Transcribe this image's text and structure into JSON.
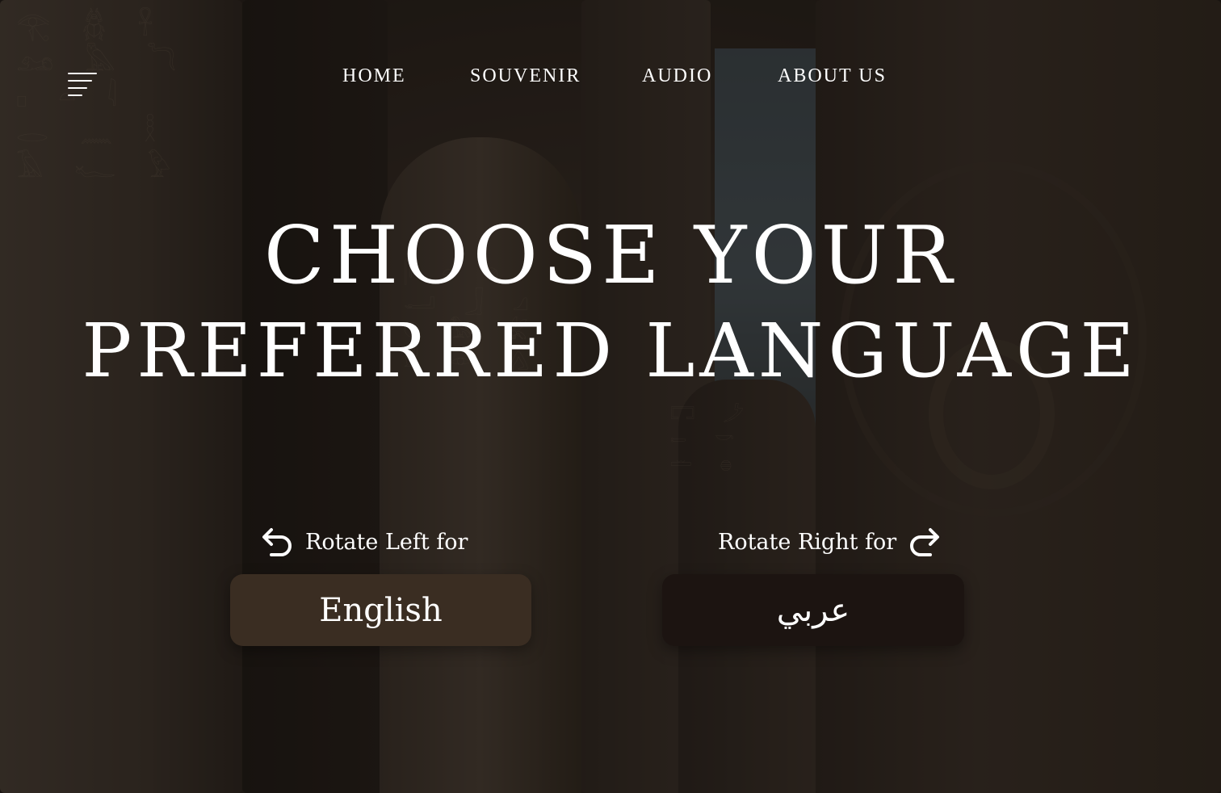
{
  "nav": {
    "items": [
      "HOME",
      "SOUVENIR",
      "AUDIO",
      "ABOUT US"
    ]
  },
  "hero": {
    "title_line1": "CHOOSE YOUR",
    "title_line2": "PREFERRED LANGUAGE"
  },
  "language": {
    "left_prompt": "Rotate Left for",
    "right_prompt": "Rotate Right for",
    "english_label": "English",
    "arabic_label": "عربي"
  },
  "icons": {
    "menu": "menu-icon",
    "rotate_left": "rotate-left-icon",
    "rotate_right": "rotate-right-icon"
  },
  "colors": {
    "text": "#ffffff",
    "english_button": "#3a2d22",
    "arabic_button": "#1c1411"
  }
}
